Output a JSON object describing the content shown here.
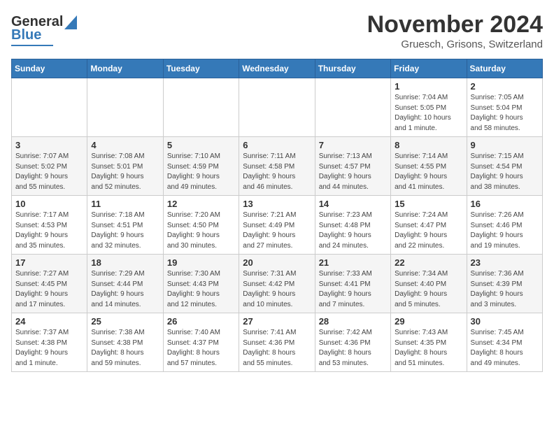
{
  "header": {
    "logo_line1": "General",
    "logo_line2": "Blue",
    "month": "November 2024",
    "location": "Gruesch, Grisons, Switzerland"
  },
  "weekdays": [
    "Sunday",
    "Monday",
    "Tuesday",
    "Wednesday",
    "Thursday",
    "Friday",
    "Saturday"
  ],
  "weeks": [
    [
      {
        "day": "",
        "info": ""
      },
      {
        "day": "",
        "info": ""
      },
      {
        "day": "",
        "info": ""
      },
      {
        "day": "",
        "info": ""
      },
      {
        "day": "",
        "info": ""
      },
      {
        "day": "1",
        "info": "Sunrise: 7:04 AM\nSunset: 5:05 PM\nDaylight: 10 hours\nand 1 minute."
      },
      {
        "day": "2",
        "info": "Sunrise: 7:05 AM\nSunset: 5:04 PM\nDaylight: 9 hours\nand 58 minutes."
      }
    ],
    [
      {
        "day": "3",
        "info": "Sunrise: 7:07 AM\nSunset: 5:02 PM\nDaylight: 9 hours\nand 55 minutes."
      },
      {
        "day": "4",
        "info": "Sunrise: 7:08 AM\nSunset: 5:01 PM\nDaylight: 9 hours\nand 52 minutes."
      },
      {
        "day": "5",
        "info": "Sunrise: 7:10 AM\nSunset: 4:59 PM\nDaylight: 9 hours\nand 49 minutes."
      },
      {
        "day": "6",
        "info": "Sunrise: 7:11 AM\nSunset: 4:58 PM\nDaylight: 9 hours\nand 46 minutes."
      },
      {
        "day": "7",
        "info": "Sunrise: 7:13 AM\nSunset: 4:57 PM\nDaylight: 9 hours\nand 44 minutes."
      },
      {
        "day": "8",
        "info": "Sunrise: 7:14 AM\nSunset: 4:55 PM\nDaylight: 9 hours\nand 41 minutes."
      },
      {
        "day": "9",
        "info": "Sunrise: 7:15 AM\nSunset: 4:54 PM\nDaylight: 9 hours\nand 38 minutes."
      }
    ],
    [
      {
        "day": "10",
        "info": "Sunrise: 7:17 AM\nSunset: 4:53 PM\nDaylight: 9 hours\nand 35 minutes."
      },
      {
        "day": "11",
        "info": "Sunrise: 7:18 AM\nSunset: 4:51 PM\nDaylight: 9 hours\nand 32 minutes."
      },
      {
        "day": "12",
        "info": "Sunrise: 7:20 AM\nSunset: 4:50 PM\nDaylight: 9 hours\nand 30 minutes."
      },
      {
        "day": "13",
        "info": "Sunrise: 7:21 AM\nSunset: 4:49 PM\nDaylight: 9 hours\nand 27 minutes."
      },
      {
        "day": "14",
        "info": "Sunrise: 7:23 AM\nSunset: 4:48 PM\nDaylight: 9 hours\nand 24 minutes."
      },
      {
        "day": "15",
        "info": "Sunrise: 7:24 AM\nSunset: 4:47 PM\nDaylight: 9 hours\nand 22 minutes."
      },
      {
        "day": "16",
        "info": "Sunrise: 7:26 AM\nSunset: 4:46 PM\nDaylight: 9 hours\nand 19 minutes."
      }
    ],
    [
      {
        "day": "17",
        "info": "Sunrise: 7:27 AM\nSunset: 4:45 PM\nDaylight: 9 hours\nand 17 minutes."
      },
      {
        "day": "18",
        "info": "Sunrise: 7:29 AM\nSunset: 4:44 PM\nDaylight: 9 hours\nand 14 minutes."
      },
      {
        "day": "19",
        "info": "Sunrise: 7:30 AM\nSunset: 4:43 PM\nDaylight: 9 hours\nand 12 minutes."
      },
      {
        "day": "20",
        "info": "Sunrise: 7:31 AM\nSunset: 4:42 PM\nDaylight: 9 hours\nand 10 minutes."
      },
      {
        "day": "21",
        "info": "Sunrise: 7:33 AM\nSunset: 4:41 PM\nDaylight: 9 hours\nand 7 minutes."
      },
      {
        "day": "22",
        "info": "Sunrise: 7:34 AM\nSunset: 4:40 PM\nDaylight: 9 hours\nand 5 minutes."
      },
      {
        "day": "23",
        "info": "Sunrise: 7:36 AM\nSunset: 4:39 PM\nDaylight: 9 hours\nand 3 minutes."
      }
    ],
    [
      {
        "day": "24",
        "info": "Sunrise: 7:37 AM\nSunset: 4:38 PM\nDaylight: 9 hours\nand 1 minute."
      },
      {
        "day": "25",
        "info": "Sunrise: 7:38 AM\nSunset: 4:38 PM\nDaylight: 8 hours\nand 59 minutes."
      },
      {
        "day": "26",
        "info": "Sunrise: 7:40 AM\nSunset: 4:37 PM\nDaylight: 8 hours\nand 57 minutes."
      },
      {
        "day": "27",
        "info": "Sunrise: 7:41 AM\nSunset: 4:36 PM\nDaylight: 8 hours\nand 55 minutes."
      },
      {
        "day": "28",
        "info": "Sunrise: 7:42 AM\nSunset: 4:36 PM\nDaylight: 8 hours\nand 53 minutes."
      },
      {
        "day": "29",
        "info": "Sunrise: 7:43 AM\nSunset: 4:35 PM\nDaylight: 8 hours\nand 51 minutes."
      },
      {
        "day": "30",
        "info": "Sunrise: 7:45 AM\nSunset: 4:34 PM\nDaylight: 8 hours\nand 49 minutes."
      }
    ]
  ]
}
